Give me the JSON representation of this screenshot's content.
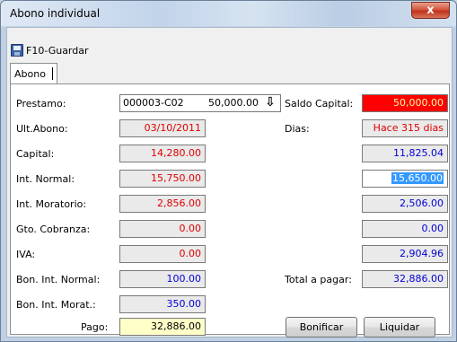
{
  "window": {
    "title": "Abono individual",
    "close_glyph": "x"
  },
  "toolbar": {
    "save_label": "F10-Guardar",
    "save_icon": "save-icon"
  },
  "tabs": [
    {
      "label": "Abono"
    }
  ],
  "form": {
    "prestamo": {
      "label": "Prestamo:",
      "code": "000003-C02",
      "amount": "50,000.00",
      "lookup_glyph": "⇩"
    },
    "saldo_capital": {
      "label": "Saldo Capital:",
      "value": "50,000.00"
    },
    "ult_abono": {
      "label": "Ult.Abono:",
      "value": "03/10/2011"
    },
    "dias": {
      "label": "Dias:",
      "value": "Hace 315 dias"
    },
    "capital": {
      "label": "Capital:",
      "value": "14,280.00",
      "right_value": "11,825.04"
    },
    "int_normal": {
      "label": "Int. Normal:",
      "value": "15,750.00",
      "right_value": "15,650.00"
    },
    "int_moratorio": {
      "label": "Int. Moratorio:",
      "value": "2,856.00",
      "right_value": "2,506.00"
    },
    "gto_cobranza": {
      "label": "Gto. Cobranza:",
      "value": "0.00",
      "right_value": "0.00"
    },
    "iva": {
      "label": "IVA:",
      "value": "0.00",
      "right_value": "2,904.96"
    },
    "bon_int_normal": {
      "label": "Bon. Int. Normal:",
      "value": "100.00"
    },
    "total_pagar": {
      "label": "Total a pagar:",
      "value": "32,886.00"
    },
    "bon_int_morat": {
      "label": "Bon. Int. Morat.:",
      "value": "350.00"
    },
    "pago": {
      "label": "Pago:",
      "value": "32,886.00"
    }
  },
  "buttons": {
    "bonificar": "Bonificar",
    "liquidar": "Liquidar"
  },
  "colors": {
    "red_text": "#e00000",
    "blue_text": "#0000d8",
    "saldo_bg": "#ff0000",
    "pago_bg": "#ffffc8",
    "selection": "#3399ff"
  }
}
